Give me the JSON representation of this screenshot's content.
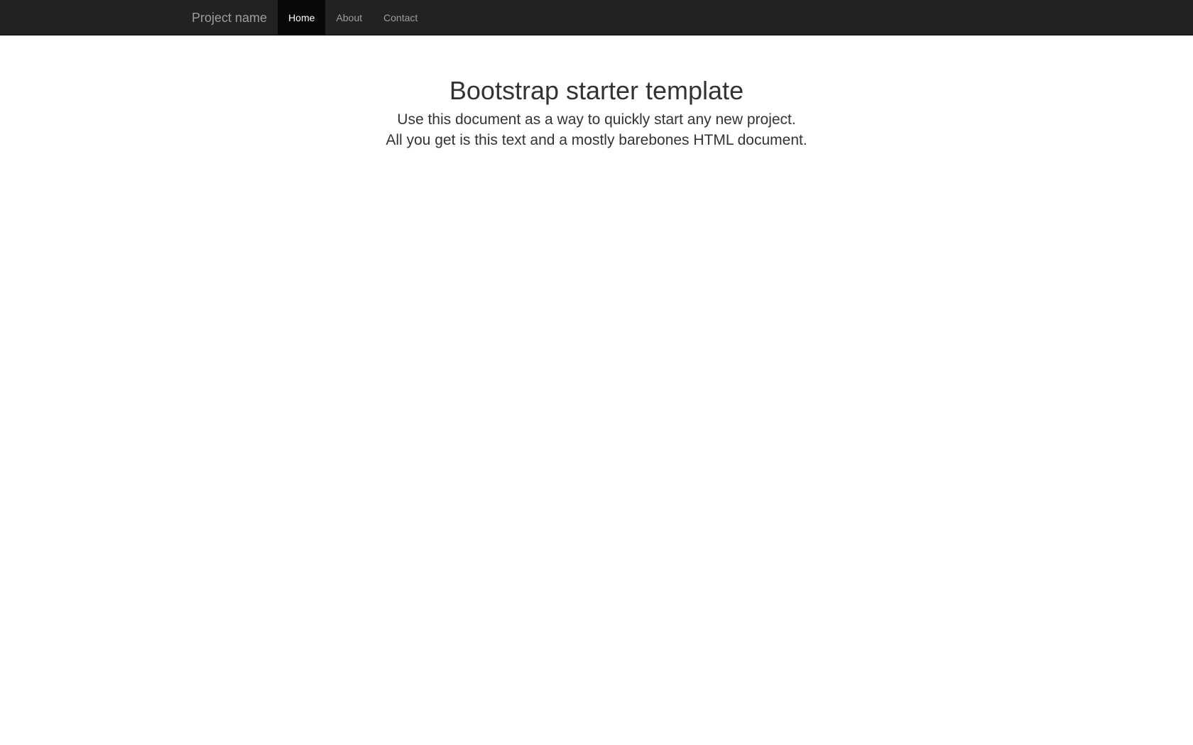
{
  "navbar": {
    "brand": "Project name",
    "items": [
      {
        "label": "Home",
        "active": true
      },
      {
        "label": "About",
        "active": false
      },
      {
        "label": "Contact",
        "active": false
      }
    ]
  },
  "main": {
    "title": "Bootstrap starter template",
    "lead_line1": "Use this document as a way to quickly start any new project.",
    "lead_line2": "All you get is this text and a mostly barebones HTML document."
  },
  "colors": {
    "navbar_bg": "#222222",
    "active_bg": "#080808",
    "nav_text": "#9d9d9d",
    "active_text": "#ffffff",
    "body_text": "#333333"
  }
}
